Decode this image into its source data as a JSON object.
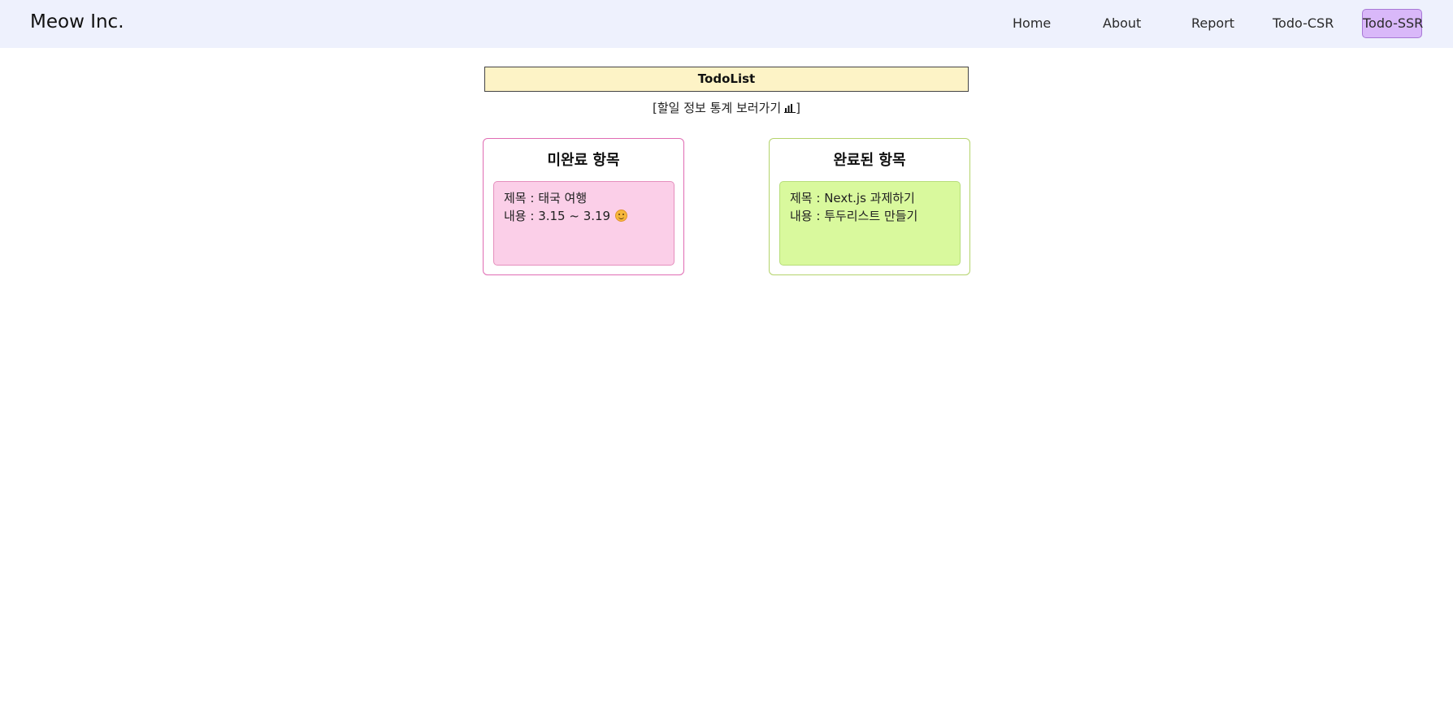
{
  "navbar": {
    "brand": "Meow Inc.",
    "links": [
      "Home",
      "About",
      "Report",
      "Todo-CSR"
    ],
    "active_link": "Todo-SSR",
    "colors": {
      "background": "#eef1fd",
      "active": "#d9b8f9"
    }
  },
  "main": {
    "title": "TodoList",
    "stats_link": {
      "prefix": "[할일 정보 통계 보러가기",
      "icon": "bar-chart-icon",
      "suffix": "]"
    },
    "columns": [
      {
        "title": "미완료 항목",
        "color": "#fbcfe8",
        "items": [
          {
            "title": "제목 : 태국 여행",
            "content": "내용 : 3.15 ~ 3.19",
            "icon": "smiling-face-icon"
          }
        ]
      },
      {
        "title": "완료된 항목",
        "color": "#d9f99d",
        "items": [
          {
            "title": "제목 : Next.js 과제하기",
            "content": "내용 : 투두리스트 만들기"
          }
        ]
      }
    ]
  }
}
